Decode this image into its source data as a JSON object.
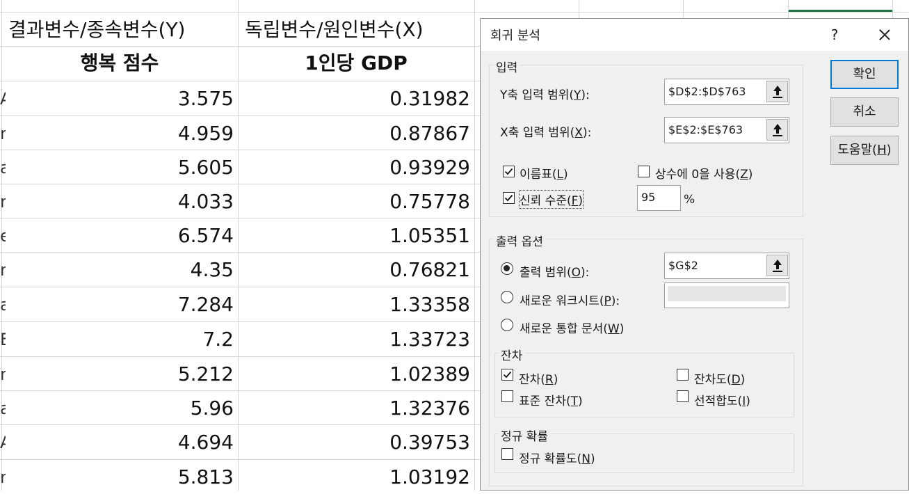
{
  "sheet": {
    "header_row1": {
      "colD": "결과변수/종속변수(Y)",
      "colE": "독립변수/원인변수(X)"
    },
    "header_row2": {
      "colD": "행복 점수",
      "colE": "1인당 GDP"
    },
    "row_fragments": [
      "A",
      "n",
      "a",
      "r",
      "e",
      "n",
      "a",
      "E",
      "n",
      "a",
      "A",
      "n"
    ],
    "rows": [
      {
        "y": "3.575",
        "x": "0.31982"
      },
      {
        "y": "4.959",
        "x": "0.87867"
      },
      {
        "y": "5.605",
        "x": "0.93929"
      },
      {
        "y": "4.033",
        "x": "0.75778"
      },
      {
        "y": "6.574",
        "x": "1.05351"
      },
      {
        "y": "4.35",
        "x": "0.76821"
      },
      {
        "y": "7.284",
        "x": "1.33358"
      },
      {
        "y": "7.2",
        "x": "1.33723"
      },
      {
        "y": "5.212",
        "x": "1.02389"
      },
      {
        "y": "5.96",
        "x": "1.32376"
      },
      {
        "y": "4.694",
        "x": "0.39753"
      },
      {
        "y": "5.813",
        "x": "1.03192"
      }
    ],
    "accent_color": "#217346"
  },
  "dialog": {
    "title": "회귀 분석",
    "help": "?",
    "input_group": {
      "label": "입력",
      "y_range_label": "Y축 입력 범위(",
      "y_range_key": "Y",
      "y_range_value": "$D$2:$D$763",
      "x_range_label": "X축 입력 범위(",
      "x_range_key": "X",
      "x_range_value": "$E$2:$E$763",
      "labels_check": {
        "text": "이름표(",
        "key": "L",
        "checked": true
      },
      "constant_zero_check": {
        "text": "상수에 0을 사용(",
        "key": "Z",
        "checked": false
      },
      "confidence_check": {
        "text": "신뢰 수준(",
        "key": "F",
        "checked": true
      },
      "confidence_value": "95",
      "percent": "%"
    },
    "output_group": {
      "label": "출력 옵션",
      "output_range": {
        "text": "출력 범위(",
        "key": "O",
        "value": "$G$2",
        "selected": true
      },
      "new_worksheet": {
        "text": "새로운 워크시트(",
        "key": "P",
        "selected": false
      },
      "new_workbook": {
        "text": "새로운 통합 문서(",
        "key": "W",
        "selected": false
      }
    },
    "residuals_group": {
      "label": "잔차",
      "residuals": {
        "text": "잔차(",
        "key": "R",
        "checked": true
      },
      "standardized": {
        "text": "표준 잔차(",
        "key": "T",
        "checked": false
      },
      "residual_plots": {
        "text": "잔차도(",
        "key": "D",
        "checked": false
      },
      "line_fit_plots": {
        "text": "선적합도(",
        "key": "I",
        "checked": false
      }
    },
    "normal_group": {
      "label": "정규 확률",
      "normal_plots": {
        "text": "정규 확률도(",
        "key": "N",
        "checked": false
      }
    },
    "buttons": {
      "ok": "확인",
      "cancel": "취소",
      "help_text": "도움말(",
      "help_key": "H"
    }
  }
}
